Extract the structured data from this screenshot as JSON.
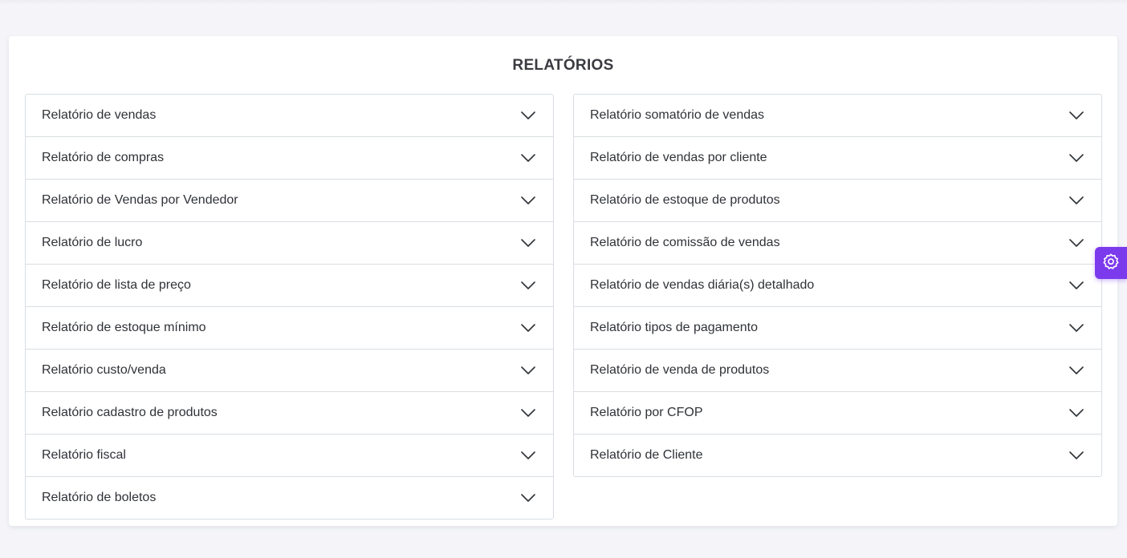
{
  "page": {
    "title": "RELATÓRIOS"
  },
  "reports_left": [
    {
      "label": "Relatório de vendas"
    },
    {
      "label": "Relatório de compras"
    },
    {
      "label": "Relatório de Vendas por Vendedor"
    },
    {
      "label": "Relatório de lucro"
    },
    {
      "label": "Relatório de lista de preço"
    },
    {
      "label": "Relatório de estoque mínimo"
    },
    {
      "label": "Relatório custo/venda"
    },
    {
      "label": "Relatório cadastro de produtos"
    },
    {
      "label": "Relatório fiscal"
    },
    {
      "label": "Relatório de boletos"
    }
  ],
  "reports_right": [
    {
      "label": "Relatório somatório de vendas"
    },
    {
      "label": "Relatório de vendas por cliente"
    },
    {
      "label": "Relatório de estoque de produtos"
    },
    {
      "label": "Relatório de comissão de vendas"
    },
    {
      "label": "Relatório de vendas diária(s) detalhado"
    },
    {
      "label": "Relatório tipos de pagamento"
    },
    {
      "label": "Relatório de venda de produtos"
    },
    {
      "label": "Relatório por CFOP"
    },
    {
      "label": "Relatório de Cliente"
    }
  ],
  "icons": {
    "expand": "chevron-down-icon",
    "settings": "gear-icon"
  },
  "colors": {
    "accent": "#7c3aed",
    "background": "#f5f5f9",
    "card": "#ffffff",
    "border": "#d9dee3"
  }
}
